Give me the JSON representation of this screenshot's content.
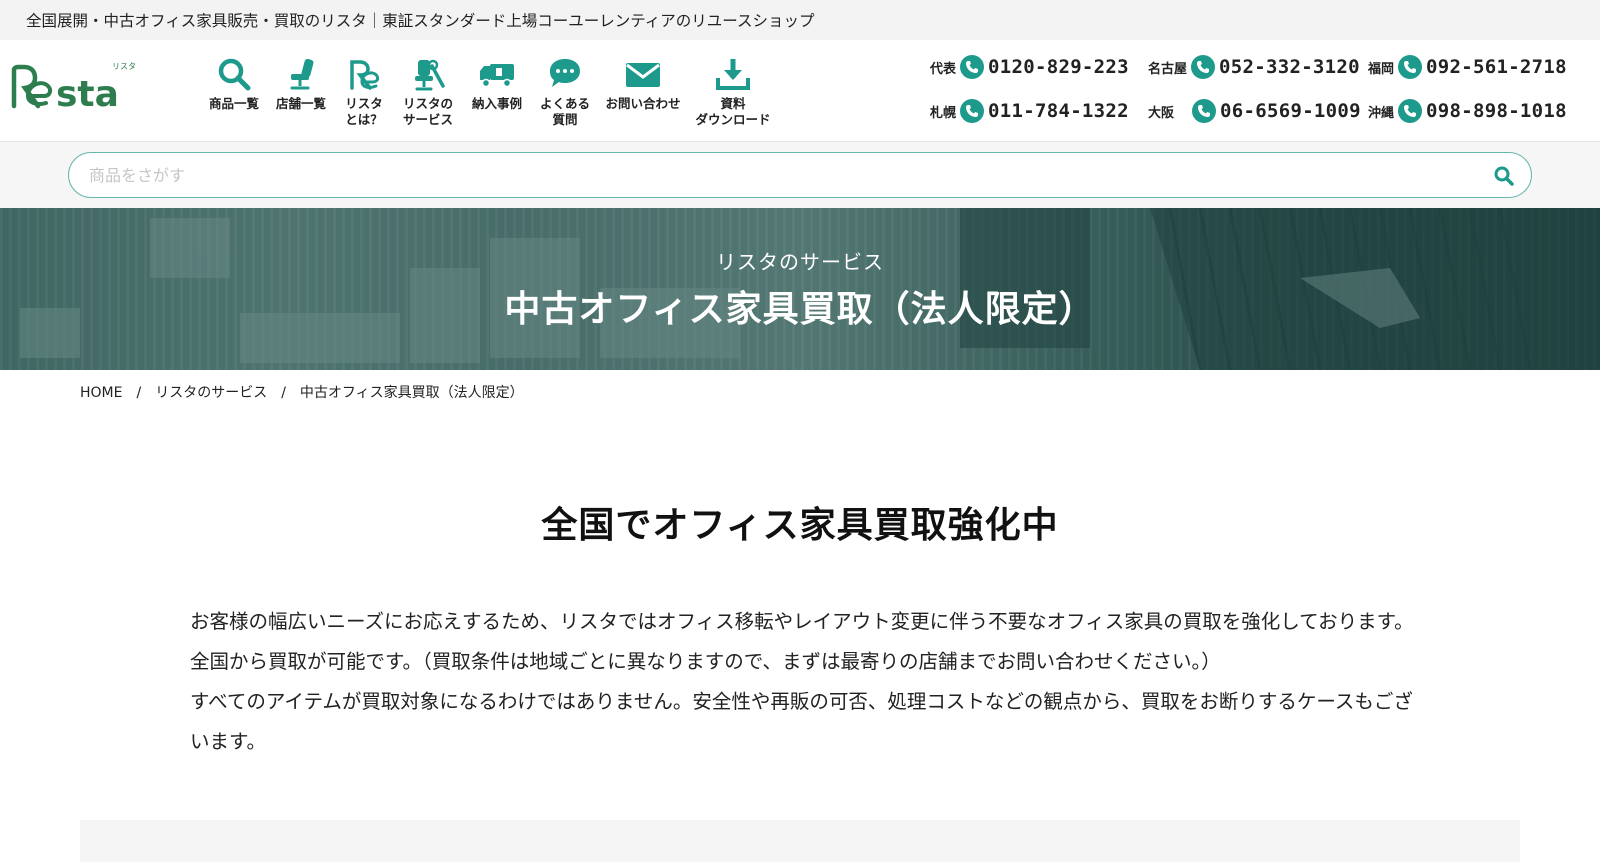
{
  "topbar": {
    "tagline": "全国展開・中古オフィス家具販売・買取のリスタ｜東証スタンダード上場コーユーレンティアのリユースショップ"
  },
  "logo": {
    "text": "Resta",
    "ruby": "リスタ"
  },
  "nav": [
    {
      "label": "商品一覧",
      "icon": "search-icon"
    },
    {
      "label": "店舗一覧",
      "icon": "office-chair-icon"
    },
    {
      "label": "リスタ\nとは？",
      "icon": "resta-logo-icon"
    },
    {
      "label": "リスタの\nサービス",
      "icon": "chair-repair-icon"
    },
    {
      "label": "納入事例",
      "icon": "truck-icon"
    },
    {
      "label": "よくある\n質問",
      "icon": "chat-bubble-icon"
    },
    {
      "label": "お問い合わせ",
      "icon": "mail-icon"
    },
    {
      "label": "資料\nダウンロード",
      "icon": "download-icon"
    }
  ],
  "phones": [
    {
      "city": "代表",
      "number": "0120-829-223"
    },
    {
      "city": "名古屋",
      "number": "052-332-3120"
    },
    {
      "city": "福岡",
      "number": "092-561-2718"
    },
    {
      "city": "札幌",
      "number": "011-784-1322"
    },
    {
      "city": "大阪",
      "number": "06-6569-1009"
    },
    {
      "city": "沖縄",
      "number": "098-898-1018"
    }
  ],
  "search": {
    "placeholder": "商品をさがす",
    "value": ""
  },
  "hero": {
    "subtitle": "リスタのサービス",
    "title": "中古オフィス家具買取（法人限定）"
  },
  "breadcrumb": [
    {
      "label": "HOME"
    },
    {
      "label": "リスタのサービス"
    },
    {
      "label": "中古オフィス家具買取（法人限定）"
    }
  ],
  "content": {
    "heading": "全国でオフィス家具買取強化中",
    "paragraph1": "お客様の幅広いニーズにお応えするため、リスタではオフィス移転やレイアウト変更に伴う不要なオフィス家具の買取を強化しております。全国から買取が可能です。（買取条件は地域ごとに異なりますので、まずは最寄りの店舗までお問い合わせください。）",
    "paragraph2": "すべてのアイテムが買取対象になるわけではありません。安全性や再販の可否、処理コストなどの観点から、買取をお断りするケースもございます。"
  },
  "colors": {
    "brand_green": "#2e7d4f",
    "accent_teal": "#1d9a8c",
    "search_border": "#67b7ae"
  }
}
